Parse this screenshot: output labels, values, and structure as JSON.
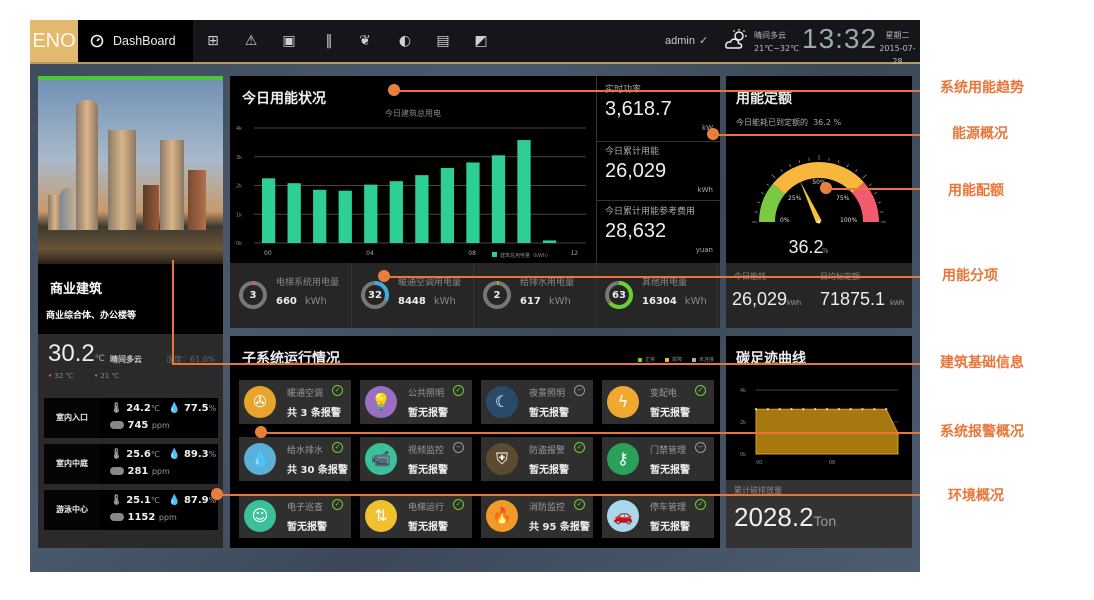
{
  "topbar": {
    "logo": "ENO",
    "dashboard_label": "DashBoard",
    "nav_icons": [
      "monitor-pulse-icon",
      "warning-icon",
      "water-meter-icon",
      "barcode-icon",
      "leaf-icon",
      "pie-icon",
      "report-search-icon",
      "export-icon"
    ],
    "user": "admin",
    "weather": "晴间多云",
    "temp_range": "21℃~32℃",
    "time": "13:32",
    "weekday": "星期二",
    "date": "2015-07-28"
  },
  "building": {
    "type": "商业建筑",
    "description": "商业综合体、办公楼等",
    "temperature": "30.2",
    "temp_unit": "℃",
    "weather": "晴间多云",
    "humidity_label": "湿度：61.0%",
    "high": "32 ℃",
    "low": "21 ℃"
  },
  "environment": [
    {
      "location": "室内入口",
      "temp": "24.2",
      "humidity": "77.5",
      "co2": "745"
    },
    {
      "location": "室内中庭",
      "temp": "25.6",
      "humidity": "89.3",
      "co2": "281"
    },
    {
      "location": "游泳中心",
      "temp": "25.1",
      "humidity": "87.9",
      "co2": "1152"
    }
  ],
  "env_units": {
    "temp": "℃",
    "humidity": "%",
    "co2": "ppm"
  },
  "energy": {
    "title": "今日用能状况",
    "realtime_label": "实时功率",
    "realtime_value": "3,618.7",
    "realtime_unit": "kW",
    "today_label": "今日累计用能",
    "today_value": "26,029",
    "today_unit": "kWh",
    "cost_label": "今日累计用能参考费用",
    "cost_value": "28,632",
    "cost_unit": "yuan"
  },
  "chart_data": {
    "type": "bar",
    "title": "今日建筑总用电",
    "x": [
      "00",
      "01",
      "02",
      "03",
      "04",
      "05",
      "06",
      "07",
      "08",
      "09",
      "10",
      "11",
      "12"
    ],
    "x_tick_labels": [
      "00",
      "04",
      "08",
      "12"
    ],
    "values": [
      2250,
      2080,
      1850,
      1820,
      2030,
      2150,
      2360,
      2610,
      2800,
      3050,
      3580,
      90,
      0
    ],
    "ylim": [
      0,
      4000
    ],
    "y_tick_labels": [
      "0k",
      "1k",
      "2k",
      "3k",
      "4k"
    ],
    "legend": [
      "建筑总用电量（kWh）"
    ],
    "legend_position": "bottom-right",
    "color": "#2ecf94",
    "grid": true
  },
  "splits": [
    {
      "name": "电梯系统用电量",
      "percent": 3,
      "value": "660",
      "unit": "kWh",
      "color": "#e06060"
    },
    {
      "name": "暖通空调用电量",
      "percent": 32,
      "value": "8448",
      "unit": "kWh",
      "color": "#3fa9e0"
    },
    {
      "name": "给排水用电量",
      "percent": 2,
      "value": "617",
      "unit": "kWh",
      "color": "#e0a030"
    },
    {
      "name": "其他用电量",
      "percent": 63,
      "value": "16304",
      "unit": "kWh",
      "color": "#6cd031"
    }
  ],
  "quota": {
    "title": "用能定额",
    "subtitle": "今日能耗已到定额的",
    "subtitle_value": "36.2 %",
    "gauge_value": 36.2,
    "gauge_labels": [
      "0%",
      "25%",
      "50%",
      "75%",
      "100%"
    ],
    "display": "36.2",
    "display_unit": "%",
    "today_label": "今日能耗",
    "today_value": "26,029",
    "today_unit": "kWh",
    "daily_label": "日均标定额",
    "daily_value": "71875.1",
    "daily_unit": "kWh"
  },
  "subsystems": {
    "title": "子系统运行情况",
    "legend": [
      {
        "label": "正常",
        "color": "#6cd031"
      },
      {
        "label": "故障",
        "color": "#f0b429"
      },
      {
        "label": "未连接",
        "color": "#aaaaaa"
      }
    ],
    "tiles": [
      {
        "name": "暖通空调",
        "alarm": "共 3 条报警",
        "status": "ok",
        "icon": "fan-icon",
        "bg": "#e8a42c"
      },
      {
        "name": "公共照明",
        "alarm": "暂无报警",
        "status": "ok",
        "icon": "bulb-icon",
        "bg": "#9a6fc0"
      },
      {
        "name": "夜景照明",
        "alarm": "暂无报警",
        "status": "off",
        "icon": "moon-icon",
        "bg": "#2a4a6a"
      },
      {
        "name": "变配电",
        "alarm": "暂无报警",
        "status": "ok",
        "icon": "lightning-icon",
        "bg": "#f0a830"
      },
      {
        "name": "给水排水",
        "alarm": "共 30 条报警",
        "status": "ok",
        "icon": "water-drop-icon",
        "bg": "#5ab0d8"
      },
      {
        "name": "视频监控",
        "alarm": "暂无报警",
        "status": "off",
        "icon": "camera-icon",
        "bg": "#3cc09a"
      },
      {
        "name": "防盗报警",
        "alarm": "暂无报警",
        "status": "ok",
        "icon": "shield-icon",
        "bg": "#5a4a30"
      },
      {
        "name": "门禁管理",
        "alarm": "暂无报警",
        "status": "off",
        "icon": "key-icon",
        "bg": "#2aa05a"
      },
      {
        "name": "电子巡查",
        "alarm": "暂无报警",
        "status": "ok",
        "icon": "guard-icon",
        "bg": "#3cc09a"
      },
      {
        "name": "电梯运行",
        "alarm": "暂无报警",
        "status": "ok",
        "icon": "elevator-icon",
        "bg": "#f0c030"
      },
      {
        "name": "消防监控",
        "alarm": "共 95 条报警",
        "status": "ok",
        "icon": "fire-icon",
        "bg": "#f09a2a"
      },
      {
        "name": "停车管理",
        "alarm": "暂无报警",
        "status": "ok",
        "icon": "car-icon",
        "bg": "#a8d8ea"
      }
    ]
  },
  "carbon": {
    "title": "碳足迹曲线",
    "y_tick_labels": [
      "0k",
      "2k",
      "4k"
    ],
    "x_tick_labels": [
      "00",
      "08"
    ],
    "values": [
      2.8,
      2.8,
      2.8,
      2.8,
      2.8,
      2.8,
      2.8,
      2.8,
      2.8,
      2.8,
      2.8,
      2.8,
      1.3
    ],
    "ylim": [
      0,
      4
    ],
    "total_label": "累计碳排放量",
    "total_value": "2028.2",
    "total_unit": "Ton"
  },
  "annotations": [
    "系统用能趋势",
    "能源概况",
    "用能配额",
    "用能分项",
    "建筑基础信息",
    "系统报警概况",
    "环境概况"
  ]
}
